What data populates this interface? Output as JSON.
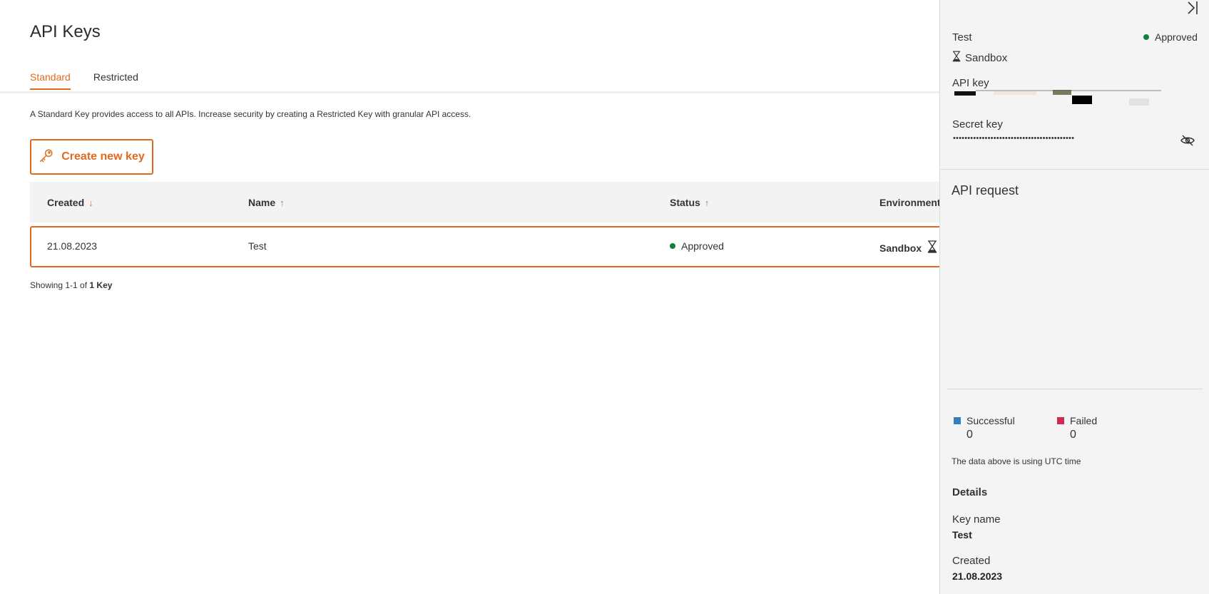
{
  "page": {
    "title": "API Keys",
    "tabs": [
      {
        "label": "Standard",
        "active": true
      },
      {
        "label": "Restricted",
        "active": false
      }
    ],
    "info_text": "A Standard Key provides access to all APIs. Increase security by creating a Restricted Key with granular API access.",
    "create_button_label": "Create new key",
    "create_button_icon": "key-icon"
  },
  "table": {
    "columns": [
      {
        "label": "Created",
        "sort": "↓",
        "sort_active": true
      },
      {
        "label": "Name",
        "sort": "↑",
        "sort_active": false
      },
      {
        "label": "Status",
        "sort": "↑",
        "sort_active": false
      },
      {
        "label": "Environment",
        "sort": "",
        "sort_active": false
      }
    ],
    "rows": [
      {
        "created": "21.08.2023",
        "name": "Test",
        "status": "Approved",
        "environment": "Sandbox"
      }
    ],
    "showing_prefix": "Showing 1-1 of ",
    "showing_count": "1 Key"
  },
  "panel": {
    "key_name": "Test",
    "status": "Approved",
    "environment": "Sandbox",
    "api_key_label": "API key",
    "secret_key_label": "Secret key",
    "secret_key_mask": "••••••••••••••••••••••••••••••••••••••••••",
    "api_request_title": "API request",
    "legend": [
      {
        "label": "Successful",
        "value": "0",
        "color": "#2f7fc1"
      },
      {
        "label": "Failed",
        "value": "0",
        "color": "#d12a52"
      }
    ],
    "utc_note": "The data above is using UTC time",
    "details_title": "Details",
    "details": [
      {
        "label": "Key name",
        "value": "Test"
      },
      {
        "label": "Created",
        "value": "21.08.2023"
      }
    ]
  },
  "colors": {
    "accent": "#e06b1f",
    "status_approved": "#12803c"
  }
}
